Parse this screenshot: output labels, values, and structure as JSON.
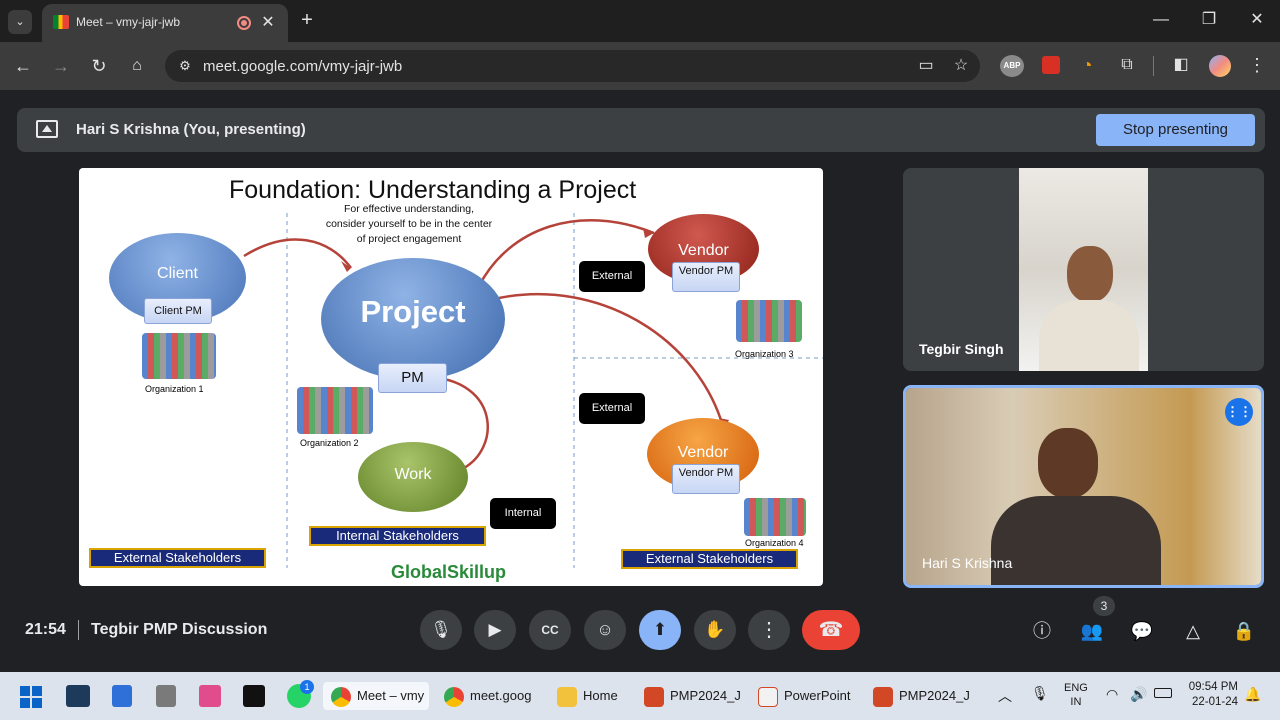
{
  "browser": {
    "tab_title": "Meet – vmy-jajr-jwb",
    "url": "meet.google.com/vmy-jajr-jwb",
    "new_tab": "+",
    "ext_abp": "ABP"
  },
  "presenting_bar": {
    "presenter": "Hari S Krishna (You, presenting)",
    "stop_label": "Stop presenting"
  },
  "slide": {
    "title": "Foundation: Understanding a Project",
    "subtitle_line1": "For effective understanding,",
    "subtitle_line2": "consider yourself to be in the center",
    "subtitle_line3": "of project engagement",
    "client": "Client",
    "client_pm": "Client PM",
    "project": "Project",
    "pm": "PM",
    "work": "Work",
    "vendor_top": "Vendor",
    "vendor_top_pm": "Vendor PM",
    "vendor_bottom": "Vendor",
    "vendor_bottom_pm": "Vendor PM",
    "external_top": "External",
    "external_mid": "External",
    "internal": "Internal",
    "org1": "Organization 1",
    "org2": "Organization 2",
    "org3": "Organization 3",
    "org4": "Organization 4",
    "ext_stake_left": "External Stakeholders",
    "int_stake": "Internal Stakeholders",
    "ext_stake_right": "External Stakeholders",
    "logo": "GlobalSkillup"
  },
  "participants": [
    {
      "name": "Tegbir Singh"
    },
    {
      "name": "Hari S Krishna"
    }
  ],
  "controls": {
    "time": "21:54",
    "meeting_name": "Tegbir PMP Discussion",
    "people_count": "3"
  },
  "taskbar": {
    "items": [
      "Meet – vmy",
      "meet.goog",
      "Home",
      "PMP2024_J",
      "PowerPoint",
      "PMP2024_J"
    ],
    "lang1": "ENG",
    "lang2": "IN",
    "clock_time": "09:54 PM",
    "clock_date": "22-01-24",
    "whatsapp_badge": "1"
  },
  "colors": {
    "accent": "#8ab4f8",
    "end_call": "#ea4335",
    "surface": "#3c4043"
  }
}
